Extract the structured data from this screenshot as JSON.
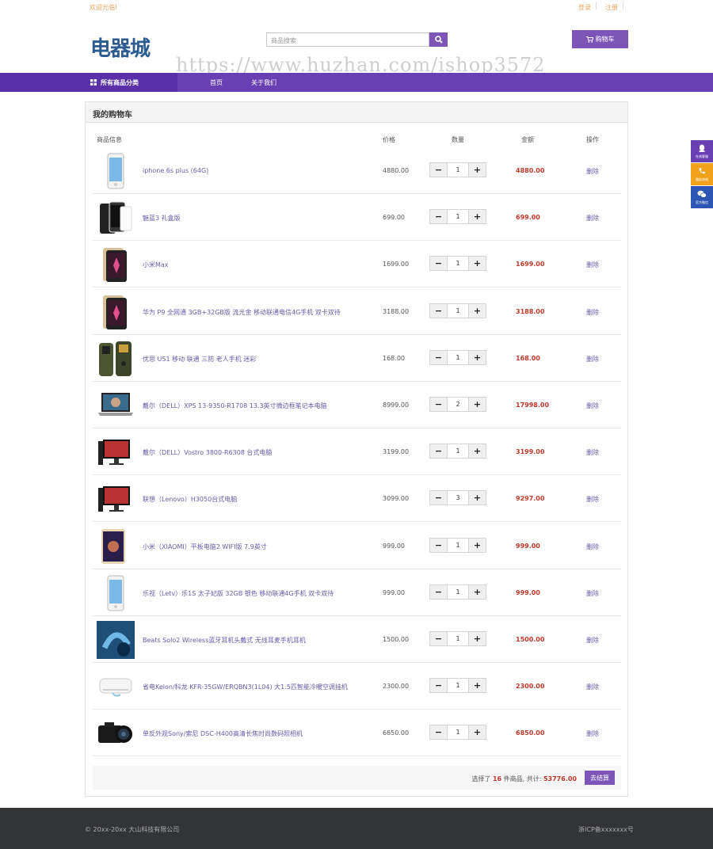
{
  "topbar": {
    "welcome": "欢迎光临!",
    "login": "登录",
    "register": "注册"
  },
  "header": {
    "logo": "电器城",
    "search_placeholder": "商品搜索",
    "cart_label": "购物车"
  },
  "watermark": "https://www.huzhan.com/ishop3572",
  "nav": {
    "all_categories": "所有商品分类",
    "links": [
      "首页",
      "关于我们"
    ]
  },
  "cart": {
    "title": "我的购物车",
    "columns": {
      "info": "商品信息",
      "price": "价格",
      "qty": "数量",
      "amount": "金额",
      "action": "操作"
    },
    "items": [
      {
        "name": "iphone 6s plus (64G)",
        "price": "4880.00",
        "qty": "1",
        "amount": "4880.00",
        "action": "删除",
        "icon": "phone-white-icon"
      },
      {
        "name": "魅蓝3 礼盒版",
        "price": "699.00",
        "qty": "1",
        "amount": "699.00",
        "action": "删除",
        "icon": "phone-black-icon"
      },
      {
        "name": "小米Max",
        "price": "1699.00",
        "qty": "1",
        "amount": "1699.00",
        "action": "删除",
        "icon": "phone-gold-icon"
      },
      {
        "name": "华为 P9 全网通 3GB+32GB版 流光金 移动联通电信4G手机 双卡双待",
        "price": "3188.00",
        "qty": "1",
        "amount": "3188.00",
        "action": "删除",
        "icon": "phone-gold-icon"
      },
      {
        "name": "优思 US1 移动 联通 三防 老人手机 迷彩",
        "price": "168.00",
        "qty": "1",
        "amount": "168.00",
        "action": "删除",
        "icon": "rugged-phone-icon"
      },
      {
        "name": "戴尔（DELL）XPS 13-9350-R1708 13.3英寸微边框笔记本电脑",
        "price": "8999.00",
        "qty": "2",
        "amount": "17998.00",
        "action": "删除",
        "icon": "laptop-icon"
      },
      {
        "name": "戴尔（DELL）Vostro 3800-R6308 台式电脑",
        "price": "3199.00",
        "qty": "1",
        "amount": "3199.00",
        "action": "删除",
        "icon": "desktop-icon"
      },
      {
        "name": "联想（Lenovo）H3050台式电脑",
        "price": "3099.00",
        "qty": "3",
        "amount": "9297.00",
        "action": "删除",
        "icon": "desktop-icon"
      },
      {
        "name": "小米（XIAOMI）平板电脑2 WIFI版 7.9英寸",
        "price": "999.00",
        "qty": "1",
        "amount": "999.00",
        "action": "删除",
        "icon": "tablet-icon"
      },
      {
        "name": "乐视（Letv）乐1S 太子妃版 32GB 银色 移动联通4G手机 双卡双待",
        "price": "999.00",
        "qty": "1",
        "amount": "999.00",
        "action": "删除",
        "icon": "phone-white-icon"
      },
      {
        "name": "Beats Solo2 Wireless蓝牙耳机头戴式 无线耳麦手机耳机",
        "price": "1500.00",
        "qty": "1",
        "amount": "1500.00",
        "action": "删除",
        "icon": "headphones-icon"
      },
      {
        "name": "省电Kelon/科龙 KFR-35GW/ERQBN3(1L04) 大1.5匹智能冷暖空调挂机",
        "price": "2300.00",
        "qty": "1",
        "amount": "2300.00",
        "action": "删除",
        "icon": "air-conditioner-icon"
      },
      {
        "name": "单反外观Sony/索尼 DSC-H400高清长焦时尚数码照相机",
        "price": "6850.00",
        "qty": "1",
        "amount": "6850.00",
        "action": "删除",
        "icon": "camera-icon"
      }
    ],
    "summary": {
      "prefix": "选择了",
      "count": "16",
      "middle": "件商品,  共计:",
      "total": "53776.00",
      "checkout": "去结算"
    }
  },
  "float_service": [
    {
      "label": "在线客服",
      "color": "#6a3fb4",
      "icon": "qq-icon"
    },
    {
      "label": "服务热线",
      "color": "#f0a21c",
      "icon": "phone-icon"
    },
    {
      "label": "官方微信",
      "color": "#2d55b3",
      "icon": "wechat-icon"
    }
  ],
  "footer": {
    "copyright": "© 20xx-20xx 大山科技有限公司",
    "icp": "浙ICP备xxxxxxx号"
  }
}
